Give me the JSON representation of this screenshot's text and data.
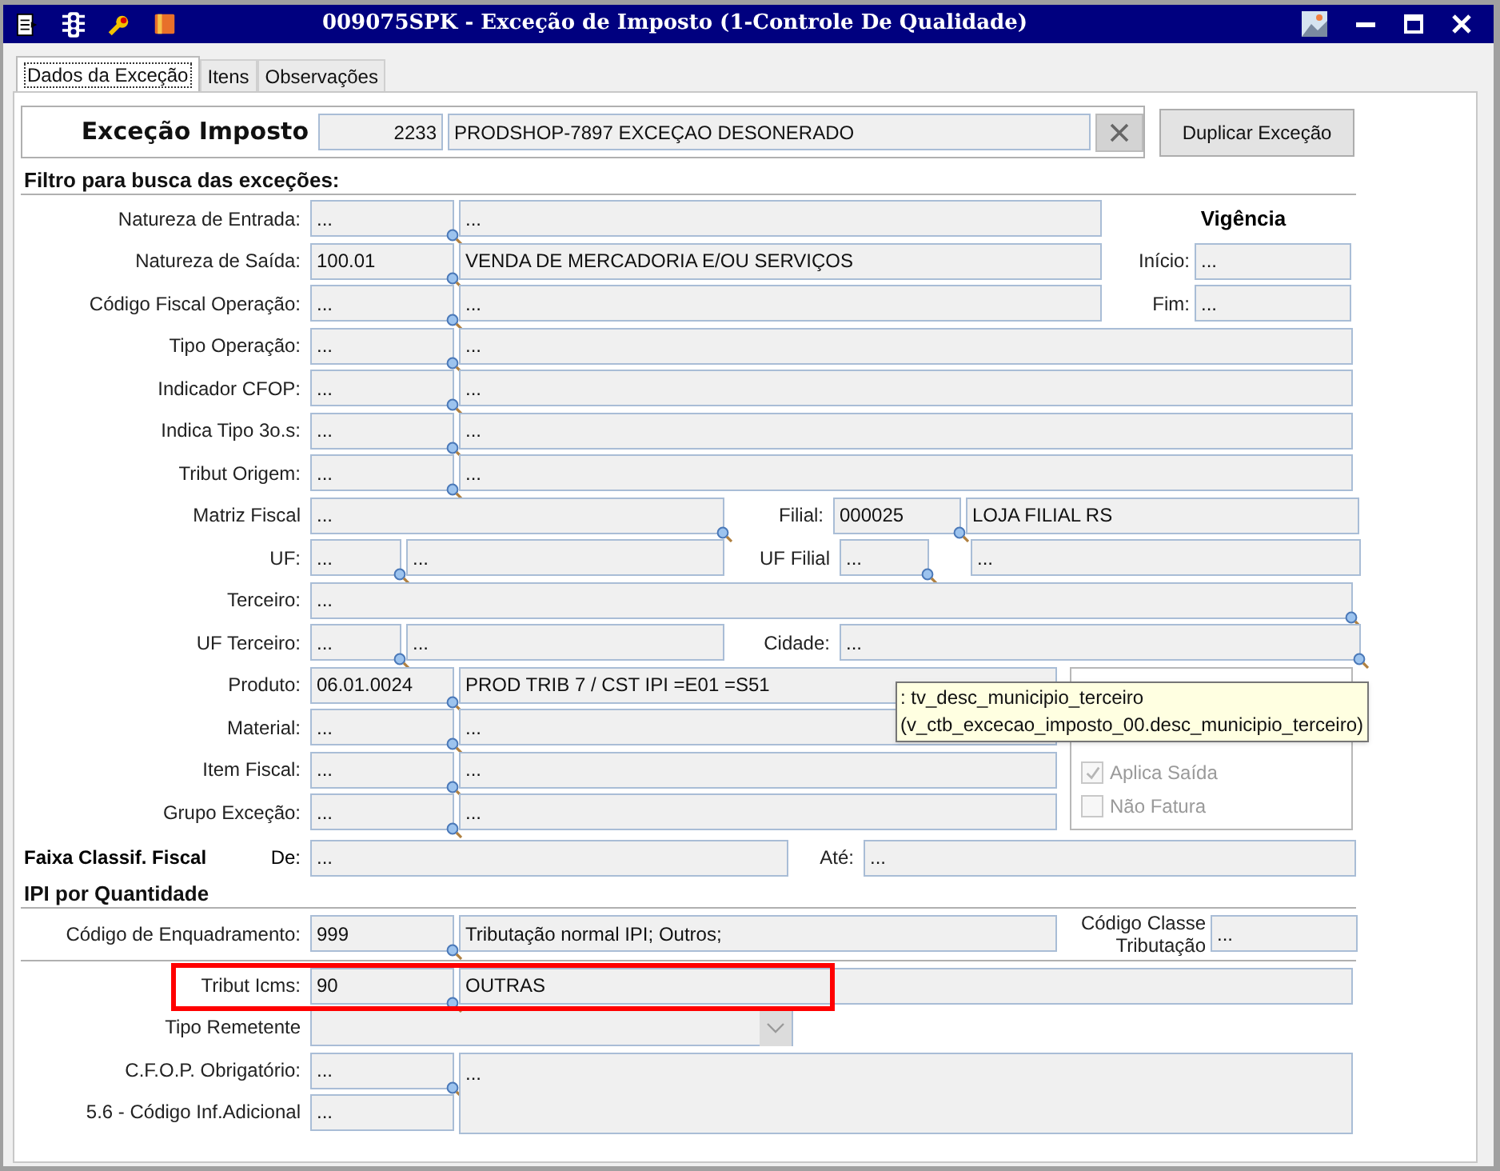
{
  "window": {
    "title": "009075SPK - Exceção de Imposto (1-Controle De Qualidade)"
  },
  "tabs": [
    {
      "label": "Dados da Exceção",
      "selected": true
    },
    {
      "label": "Itens",
      "selected": false
    },
    {
      "label": "Observações",
      "selected": false
    }
  ],
  "header": {
    "label": "Exceção Imposto",
    "code": "2233",
    "description": "PRODSHOP-7897 EXCEÇAO DESONERADO",
    "duplicate_button": "Duplicar Exceção"
  },
  "filter": {
    "title": "Filtro para busca das exceções:",
    "rows_top": [
      {
        "label": "Natureza de Entrada:",
        "code": "...",
        "description": "..."
      },
      {
        "label": "Natureza de Saída:",
        "code": "100.01",
        "description": "VENDA DE MERCADORIA E/OU SERVIÇOS"
      },
      {
        "label": "Código Fiscal Operação:",
        "code": "...",
        "description": "..."
      }
    ],
    "validity": {
      "title": "Vigência",
      "start_label": "Início:",
      "start": "...",
      "end_label": "Fim:",
      "end": "..."
    },
    "rows_mid": [
      {
        "label": "Tipo Operação:",
        "code": "...",
        "description": "..."
      },
      {
        "label": "Indicador CFOP:",
        "code": "...",
        "description": "..."
      },
      {
        "label": "Indica Tipo 3o.s:",
        "code": "...",
        "description": "..."
      },
      {
        "label": "Tribut Origem:",
        "code": "...",
        "description": "..."
      }
    ],
    "matriz": {
      "label": "Matriz Fiscal",
      "value": "..."
    },
    "filial": {
      "label": "Filial:",
      "code": "000025",
      "description": "LOJA FILIAL RS"
    },
    "uf": {
      "label": "UF:",
      "code": "...",
      "description": "..."
    },
    "uf_filial": {
      "label": "UF Filial",
      "code": "...",
      "description": "..."
    },
    "terceiro": {
      "label": "Terceiro:",
      "value": "..."
    },
    "uf_terceiro": {
      "label": "UF Terceiro:",
      "code": "...",
      "description": "..."
    },
    "cidade": {
      "label": "Cidade:",
      "value": "..."
    },
    "rows_product": [
      {
        "label": "Produto:",
        "code": "06.01.0024",
        "description": "PROD TRIB 7 / CST IPI =E01 =S51"
      },
      {
        "label": "Material:",
        "code": "...",
        "description": "..."
      },
      {
        "label": "Item Fiscal:",
        "code": "...",
        "description": "..."
      },
      {
        "label": "Grupo Exceção:",
        "code": "...",
        "description": "..."
      }
    ],
    "flags": [
      {
        "label": "Aplica Saída",
        "checked": true,
        "disabled": true
      },
      {
        "label": "Não Fatura",
        "checked": false,
        "disabled": true
      }
    ],
    "faixa": {
      "title": "Faixa Classif. Fiscal",
      "from_label": "De:",
      "from": "...",
      "to_label": "Até:",
      "to": "..."
    }
  },
  "ipi": {
    "title": "IPI por Quantidade",
    "label": "Código de Enquadramento:",
    "code": "999",
    "description": "Tributação normal IPI; Outros;",
    "class_label": "Código Classe Tributação",
    "class_value": "..."
  },
  "tribut_icms": {
    "label": "Tribut Icms:",
    "code": "90",
    "description": "OUTRAS",
    "highlighted": true
  },
  "tipo_remetente": {
    "label": "Tipo Remetente"
  },
  "cfop": {
    "label": "C.F.O.P. Obrigatório:",
    "code": "...",
    "description": "..."
  },
  "info_code": {
    "label": "5.6 - Código Inf.Adicional",
    "code": "..."
  },
  "tooltip": {
    "lines": [
      ": tv_desc_municipio_terceiro",
      "(v_ctb_excecao_imposto_00.desc_municipio_terceiro)"
    ]
  }
}
